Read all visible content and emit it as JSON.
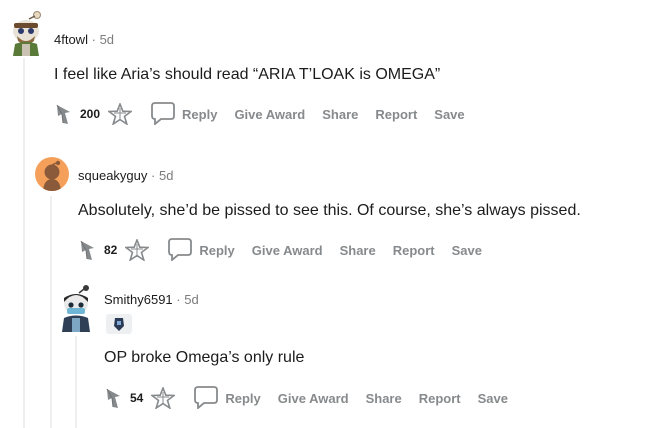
{
  "comments": [
    {
      "username": "4ftowl",
      "time": "5d",
      "body": "I feel like Aria’s should read “ARIA T’LOAK is OMEGA”",
      "score": "200",
      "actions": {
        "reply": "Reply",
        "give_award": "Give Award",
        "share": "Share",
        "report": "Report",
        "save": "Save"
      }
    },
    {
      "username": "squeakyguy",
      "time": "5d",
      "body": "Absolutely, she’d be pissed to see this. Of course, she’s always pissed.",
      "score": "82",
      "actions": {
        "reply": "Reply",
        "give_award": "Give Award",
        "share": "Share",
        "report": "Report",
        "save": "Save"
      }
    },
    {
      "username": "Smithy6591",
      "time": "5d",
      "body": "OP broke Omega’s only rule",
      "score": "54",
      "actions": {
        "reply": "Reply",
        "give_award": "Give Award",
        "share": "Share",
        "report": "Report",
        "save": "Save"
      }
    }
  ],
  "separator": "·",
  "colors": {
    "meta_gray": "#7c7c7c",
    "action_gray": "#878a8c",
    "thread_line": "#edeff1",
    "avatar_orange": "#f5a05a"
  }
}
